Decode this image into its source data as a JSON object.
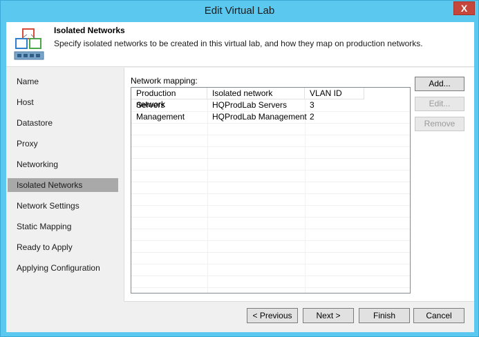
{
  "window": {
    "title": "Edit Virtual Lab",
    "close_label": "X"
  },
  "header": {
    "title": "Isolated Networks",
    "description": "Specify isolated networks to be created in this virtual lab, and how they map on production networks."
  },
  "sidebar": {
    "items": [
      {
        "label": "Name",
        "selected": false
      },
      {
        "label": "Host",
        "selected": false
      },
      {
        "label": "Datastore",
        "selected": false
      },
      {
        "label": "Proxy",
        "selected": false
      },
      {
        "label": "Networking",
        "selected": false
      },
      {
        "label": "Isolated Networks",
        "selected": true
      },
      {
        "label": "Network Settings",
        "selected": false
      },
      {
        "label": "Static Mapping",
        "selected": false
      },
      {
        "label": "Ready to Apply",
        "selected": false
      },
      {
        "label": "Applying Configuration",
        "selected": false
      }
    ]
  },
  "main": {
    "section_label": "Network mapping:",
    "columns": [
      "Production network",
      "Isolated network",
      "VLAN ID"
    ],
    "rows": [
      [
        "Servers",
        "HQProdLab Servers",
        "3"
      ],
      [
        "Management",
        "HQProdLab Management",
        "2"
      ]
    ]
  },
  "actions": {
    "add": "Add...",
    "edit": "Edit...",
    "remove": "Remove"
  },
  "footer": {
    "previous": "< Previous",
    "next": "Next >",
    "finish": "Finish",
    "cancel": "Cancel"
  },
  "colors": {
    "frame": "#5bc8ef",
    "close": "#c7463b",
    "selected": "#a9a9a9"
  }
}
